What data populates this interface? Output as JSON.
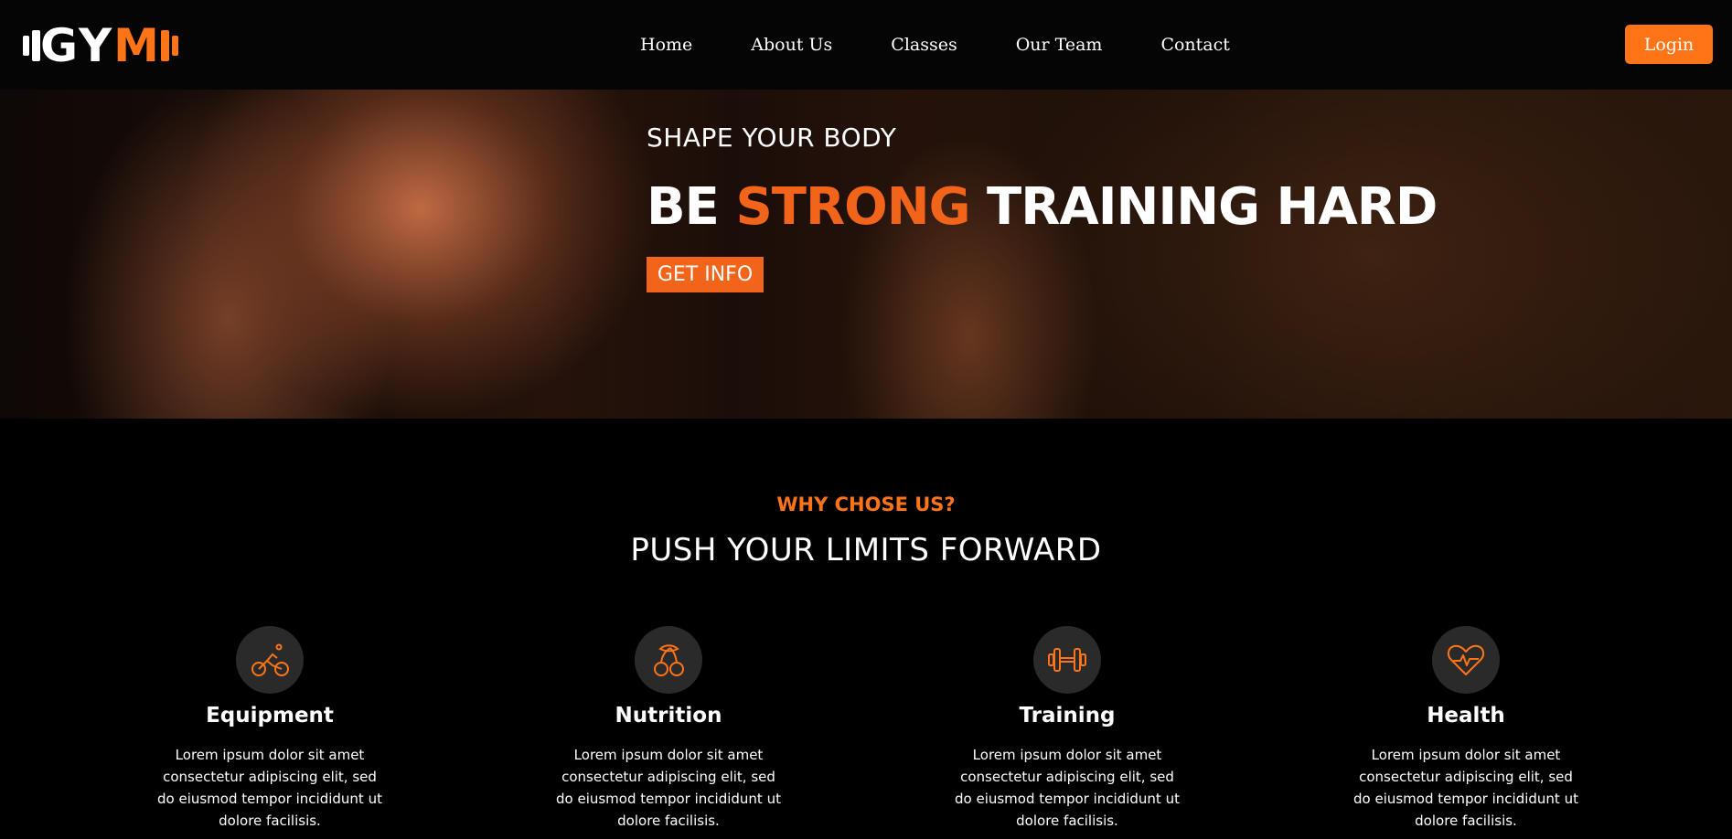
{
  "brand": {
    "logo_text_white": "GY",
    "logo_text_orange": "M"
  },
  "nav": {
    "items": [
      {
        "label": "Home"
      },
      {
        "label": "About Us"
      },
      {
        "label": "Classes"
      },
      {
        "label": "Our Team"
      },
      {
        "label": "Contact"
      }
    ],
    "login_label": "Login"
  },
  "hero": {
    "subtitle": "SHAPE YOUR BODY",
    "title_prefix": "BE",
    "title_accent": "STRONG",
    "title_suffix": "TRAINING HARD",
    "button_label": "GET INFO"
  },
  "why": {
    "label": "WHY CHOSE US?",
    "heading": "PUSH YOUR LIMITS FORWARD",
    "features": [
      {
        "icon": "bicycle-icon",
        "title": "Equipment",
        "text": "Lorem ipsum dolor sit amet consectetur adipiscing elit, sed do eiusmod tempor incididunt ut dolore facilisis."
      },
      {
        "icon": "cherries-icon",
        "title": "Nutrition",
        "text": "Lorem ipsum dolor sit amet consectetur adipiscing elit, sed do eiusmod tempor incididunt ut dolore facilisis."
      },
      {
        "icon": "dumbbell-icon",
        "title": "Training",
        "text": "Lorem ipsum dolor sit amet consectetur adipiscing elit, sed do eiusmod tempor incididunt ut dolore facilisis."
      },
      {
        "icon": "heart-pulse-icon",
        "title": "Health",
        "text": "Lorem ipsum dolor sit amet consectetur adipiscing elit, sed do eiusmod tempor incididunt ut dolore facilisis."
      }
    ]
  },
  "colors": {
    "accent": "#ff7417",
    "accent_dark": "#f26419",
    "background": "#000000",
    "icon_circle": "#2a2a2a"
  }
}
